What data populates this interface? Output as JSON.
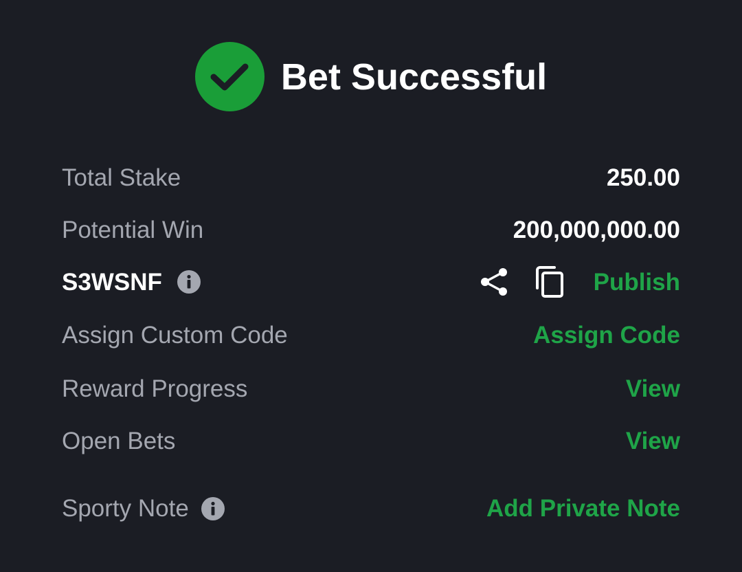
{
  "header": {
    "title": "Bet Successful",
    "icon": "check-circle-icon",
    "icon_color": "#1a9e38"
  },
  "rows": {
    "total_stake": {
      "label": "Total Stake",
      "value": "250.00"
    },
    "potential_win": {
      "label": "Potential Win",
      "value": "200,000,000.00"
    },
    "booking_code": {
      "code": "S3WSNF",
      "publish_label": "Publish"
    },
    "custom_code": {
      "label": "Assign Custom Code",
      "link": "Assign Code"
    },
    "reward_progress": {
      "label": "Reward Progress",
      "link": "View"
    },
    "open_bets": {
      "label": "Open Bets",
      "link": "View"
    },
    "sporty_note": {
      "label": "Sporty Note",
      "link": "Add Private Note"
    }
  },
  "colors": {
    "background": "#1b1d24",
    "label": "#a4a7b0",
    "value": "#ffffff",
    "accent_green": "#1fa448"
  }
}
